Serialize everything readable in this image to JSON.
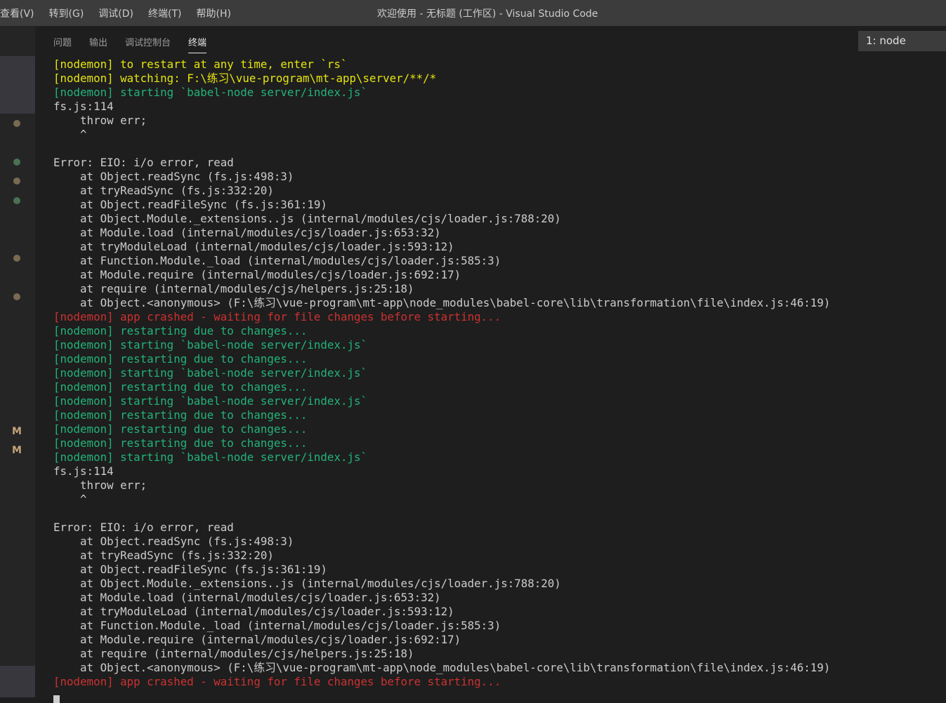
{
  "titlebar": {
    "menus": [
      "查看(V)",
      "转到(G)",
      "调试(D)",
      "终端(T)",
      "帮助(H)"
    ],
    "title": "欢迎使用 - 无标题 (工作区) - Visual Studio Code"
  },
  "panel": {
    "tabs": [
      "问题",
      "输出",
      "调试控制台",
      "终端"
    ],
    "active_tab": "终端",
    "terminal_select": "1: node"
  },
  "sidebar": {
    "marks": [
      "M",
      "M"
    ]
  },
  "colors": {
    "yellow": "#e5e510",
    "green": "#23b37a",
    "red": "#cd3131",
    "text": "#cccccc"
  },
  "terminal": {
    "lines": [
      {
        "c": "y",
        "t": "[nodemon] to restart at any time, enter `rs`"
      },
      {
        "c": "y",
        "t": "[nodemon] watching: F:\\练习\\vue-program\\mt-app\\server/**/*"
      },
      {
        "c": "g",
        "t": "[nodemon] starting `babel-node server/index.js`"
      },
      {
        "c": "w",
        "t": "fs.js:114"
      },
      {
        "c": "w",
        "t": "    throw err;"
      },
      {
        "c": "w",
        "t": "    ^"
      },
      {
        "c": "w",
        "t": ""
      },
      {
        "c": "w",
        "t": "Error: EIO: i/o error, read"
      },
      {
        "c": "w",
        "t": "    at Object.readSync (fs.js:498:3)"
      },
      {
        "c": "w",
        "t": "    at tryReadSync (fs.js:332:20)"
      },
      {
        "c": "w",
        "t": "    at Object.readFileSync (fs.js:361:19)"
      },
      {
        "c": "w",
        "t": "    at Object.Module._extensions..js (internal/modules/cjs/loader.js:788:20)"
      },
      {
        "c": "w",
        "t": "    at Module.load (internal/modules/cjs/loader.js:653:32)"
      },
      {
        "c": "w",
        "t": "    at tryModuleLoad (internal/modules/cjs/loader.js:593:12)"
      },
      {
        "c": "w",
        "t": "    at Function.Module._load (internal/modules/cjs/loader.js:585:3)"
      },
      {
        "c": "w",
        "t": "    at Module.require (internal/modules/cjs/loader.js:692:17)"
      },
      {
        "c": "w",
        "t": "    at require (internal/modules/cjs/helpers.js:25:18)"
      },
      {
        "c": "w",
        "t": "    at Object.<anonymous> (F:\\练习\\vue-program\\mt-app\\node_modules\\babel-core\\lib\\transformation\\file\\index.js:46:19)"
      },
      {
        "c": "r",
        "t": "[nodemon] app crashed - waiting for file changes before starting..."
      },
      {
        "c": "g",
        "t": "[nodemon] restarting due to changes..."
      },
      {
        "c": "g",
        "t": "[nodemon] starting `babel-node server/index.js`"
      },
      {
        "c": "g",
        "t": "[nodemon] restarting due to changes..."
      },
      {
        "c": "g",
        "t": "[nodemon] starting `babel-node server/index.js`"
      },
      {
        "c": "g",
        "t": "[nodemon] restarting due to changes..."
      },
      {
        "c": "g",
        "t": "[nodemon] starting `babel-node server/index.js`"
      },
      {
        "c": "g",
        "t": "[nodemon] restarting due to changes..."
      },
      {
        "c": "g",
        "t": "[nodemon] restarting due to changes..."
      },
      {
        "c": "g",
        "t": "[nodemon] restarting due to changes..."
      },
      {
        "c": "g",
        "t": "[nodemon] starting `babel-node server/index.js`"
      },
      {
        "c": "w",
        "t": "fs.js:114"
      },
      {
        "c": "w",
        "t": "    throw err;"
      },
      {
        "c": "w",
        "t": "    ^"
      },
      {
        "c": "w",
        "t": ""
      },
      {
        "c": "w",
        "t": "Error: EIO: i/o error, read"
      },
      {
        "c": "w",
        "t": "    at Object.readSync (fs.js:498:3)"
      },
      {
        "c": "w",
        "t": "    at tryReadSync (fs.js:332:20)"
      },
      {
        "c": "w",
        "t": "    at Object.readFileSync (fs.js:361:19)"
      },
      {
        "c": "w",
        "t": "    at Object.Module._extensions..js (internal/modules/cjs/loader.js:788:20)"
      },
      {
        "c": "w",
        "t": "    at Module.load (internal/modules/cjs/loader.js:653:32)"
      },
      {
        "c": "w",
        "t": "    at tryModuleLoad (internal/modules/cjs/loader.js:593:12)"
      },
      {
        "c": "w",
        "t": "    at Function.Module._load (internal/modules/cjs/loader.js:585:3)"
      },
      {
        "c": "w",
        "t": "    at Module.require (internal/modules/cjs/loader.js:692:17)"
      },
      {
        "c": "w",
        "t": "    at require (internal/modules/cjs/helpers.js:25:18)"
      },
      {
        "c": "w",
        "t": "    at Object.<anonymous> (F:\\练习\\vue-program\\mt-app\\node_modules\\babel-core\\lib\\transformation\\file\\index.js:46:19)"
      },
      {
        "c": "r",
        "t": "[nodemon] app crashed - waiting for file changes before starting..."
      }
    ]
  }
}
